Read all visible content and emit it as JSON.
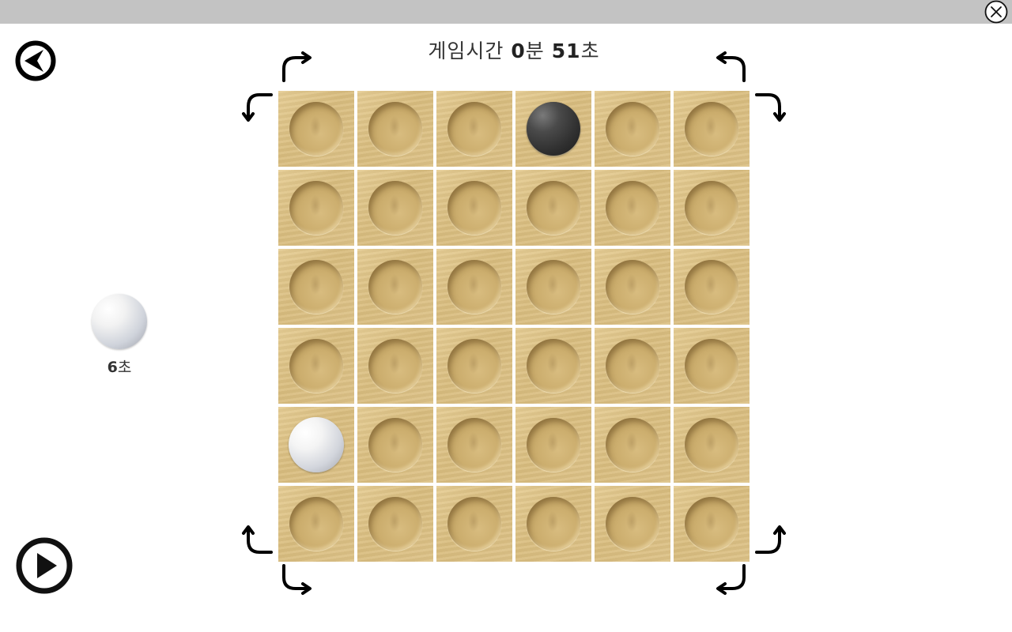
{
  "game": {
    "time_label": "게임시간",
    "minutes": "0",
    "minutes_unit": "분",
    "seconds": "51",
    "seconds_unit": "초"
  },
  "turn": {
    "stone_color": "white",
    "timer_value": "6",
    "timer_unit": "초"
  },
  "board": {
    "rows": 6,
    "cols": 6,
    "cells": [
      [
        "empty",
        "empty",
        "empty",
        "black",
        "empty",
        "empty"
      ],
      [
        "empty",
        "empty",
        "empty",
        "empty",
        "empty",
        "empty"
      ],
      [
        "empty",
        "empty",
        "empty",
        "empty",
        "empty",
        "empty"
      ],
      [
        "empty",
        "empty",
        "empty",
        "empty",
        "empty",
        "empty"
      ],
      [
        "white",
        "empty",
        "empty",
        "empty",
        "empty",
        "empty"
      ],
      [
        "empty",
        "empty",
        "empty",
        "empty",
        "empty",
        "empty"
      ]
    ]
  },
  "controls": {
    "back_icon": "back-arrow-circle-icon",
    "play_icon": "play-circle-icon",
    "close_icon": "close-circle-icon"
  },
  "colors": {
    "topbar": "#c3c3c3",
    "board_wood": "#ddc287",
    "stone_black": "#303030",
    "stone_white": "#f4f4f4"
  }
}
